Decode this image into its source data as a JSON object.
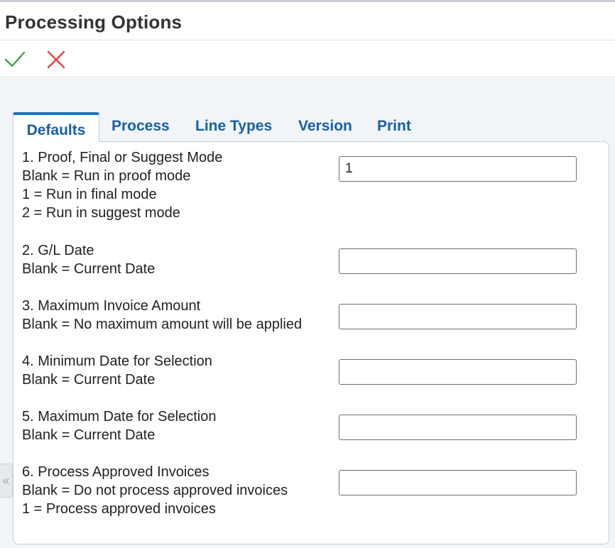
{
  "window": {
    "title": "Processing Options"
  },
  "toolbar": {
    "ok_icon": "check-icon",
    "cancel_icon": "close-icon"
  },
  "tabs": [
    {
      "label": "Defaults",
      "active": true
    },
    {
      "label": "Process",
      "active": false
    },
    {
      "label": "Line Types",
      "active": false
    },
    {
      "label": "Version",
      "active": false
    },
    {
      "label": "Print",
      "active": false
    }
  ],
  "options": [
    {
      "lines": [
        "1. Proof, Final or Suggest Mode",
        "Blank = Run in proof mode",
        "1 = Run in final mode",
        "2 = Run in suggest mode"
      ],
      "value": "1"
    },
    {
      "lines": [
        "2. G/L Date",
        "Blank = Current Date"
      ],
      "value": ""
    },
    {
      "lines": [
        "3. Maximum Invoice Amount",
        "Blank = No maximum amount will be applied"
      ],
      "value": ""
    },
    {
      "lines": [
        "4. Minimum Date for Selection",
        "Blank = Current Date"
      ],
      "value": ""
    },
    {
      "lines": [
        "5. Maximum Date for Selection",
        "Blank = Current Date"
      ],
      "value": ""
    },
    {
      "lines": [
        "6. Process Approved Invoices",
        "Blank = Do not process approved invoices",
        "1 = Process approved invoices"
      ],
      "value": ""
    }
  ],
  "sidebar": {
    "collapse_glyph": "«"
  },
  "colors": {
    "ok": "#3fa34d",
    "cancel": "#e0443e",
    "tab_link": "#1a5fa8",
    "tab_active_bar": "#1a73c6"
  }
}
